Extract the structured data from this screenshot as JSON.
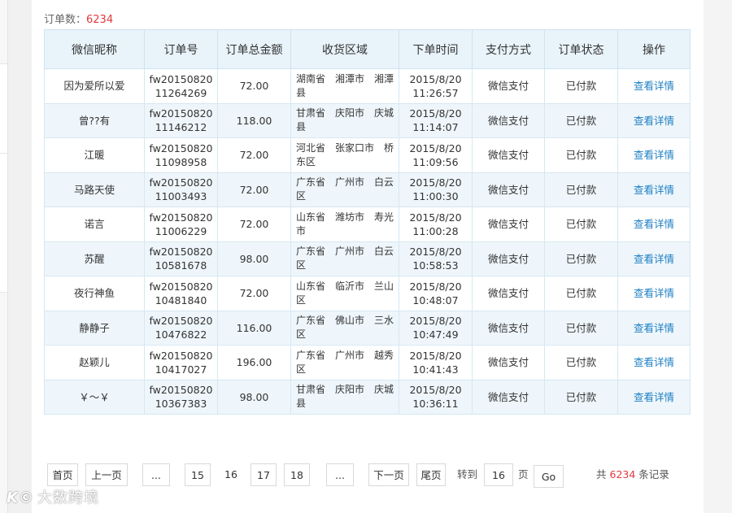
{
  "summary": {
    "label": "订单数：",
    "count": "6234"
  },
  "table": {
    "headers": [
      "微信昵称",
      "订单号",
      "订单总金额",
      "收货区域",
      "下单时间",
      "支付方式",
      "订单状态",
      "操作"
    ],
    "rows": [
      {
        "nickname": "因为爱所以爱",
        "order_no": "fw2015082011264269",
        "amount": "72.00",
        "region": "湖南省　湘潭市　湘潭县",
        "time_date": "2015/8/20",
        "time_clock": "11:26:57",
        "payment": "微信支付",
        "status": "已付款",
        "action": "查看详情"
      },
      {
        "nickname": "曾??有",
        "order_no": "fw2015082011146212",
        "amount": "118.00",
        "region": "甘肃省　庆阳市　庆城县",
        "time_date": "2015/8/20",
        "time_clock": "11:14:07",
        "payment": "微信支付",
        "status": "已付款",
        "action": "查看详情"
      },
      {
        "nickname": "江暖",
        "order_no": "fw2015082011098958",
        "amount": "72.00",
        "region": "河北省　张家口市　桥东区",
        "time_date": "2015/8/20",
        "time_clock": "11:09:56",
        "payment": "微信支付",
        "status": "已付款",
        "action": "查看详情"
      },
      {
        "nickname": "马路天使",
        "order_no": "fw2015082011003493",
        "amount": "72.00",
        "region": "广东省　广州市　白云区",
        "time_date": "2015/8/20",
        "time_clock": "11:00:30",
        "payment": "微信支付",
        "status": "已付款",
        "action": "查看详情"
      },
      {
        "nickname": "诺言",
        "order_no": "fw2015082011006229",
        "amount": "72.00",
        "region": "山东省　潍坊市　寿光市",
        "time_date": "2015/8/20",
        "time_clock": "11:00:28",
        "payment": "微信支付",
        "status": "已付款",
        "action": "查看详情"
      },
      {
        "nickname": "苏醒",
        "order_no": "fw2015082010581678",
        "amount": "98.00",
        "region": "广东省　广州市　白云区",
        "time_date": "2015/8/20",
        "time_clock": "10:58:53",
        "payment": "微信支付",
        "status": "已付款",
        "action": "查看详情"
      },
      {
        "nickname": "夜行神鱼",
        "order_no": "fw2015082010481840",
        "amount": "72.00",
        "region": "山东省　临沂市　兰山区",
        "time_date": "2015/8/20",
        "time_clock": "10:48:07",
        "payment": "微信支付",
        "status": "已付款",
        "action": "查看详情"
      },
      {
        "nickname": "静静子",
        "order_no": "fw2015082010476822",
        "amount": "116.00",
        "region": "广东省　佛山市　三水区",
        "time_date": "2015/8/20",
        "time_clock": "10:47:49",
        "payment": "微信支付",
        "status": "已付款",
        "action": "查看详情"
      },
      {
        "nickname": "赵颖儿",
        "order_no": "fw2015082010417027",
        "amount": "196.00",
        "region": "广东省　广州市　越秀区",
        "time_date": "2015/8/20",
        "time_clock": "10:41:43",
        "payment": "微信支付",
        "status": "已付款",
        "action": "查看详情"
      },
      {
        "nickname": "￥～￥",
        "order_no": "fw2015082010367383",
        "amount": "98.00",
        "region": "甘肃省　庆阳市　庆城县",
        "time_date": "2015/8/20",
        "time_clock": "10:36:11",
        "payment": "微信支付",
        "status": "已付款",
        "action": "查看详情"
      }
    ]
  },
  "pagination": {
    "first": "首页",
    "prev": "上一页",
    "ellipsis": "...",
    "pages": [
      "15",
      "16",
      "17",
      "18"
    ],
    "current": "16",
    "next": "下一页",
    "last": "尾页",
    "goto_label": "转到",
    "goto_value": "16",
    "page_unit": "页",
    "go": "Go",
    "total_prefix": "共",
    "total_count": "6234",
    "total_suffix": "条记录"
  },
  "watermark": {
    "logo": "K©",
    "text": "大数跨境"
  },
  "colors": {
    "accent_red": "#e0393e",
    "link_blue": "#1d7fc4",
    "header_bg": "#e8f3fa",
    "stripe_bg": "#eef6fb"
  }
}
